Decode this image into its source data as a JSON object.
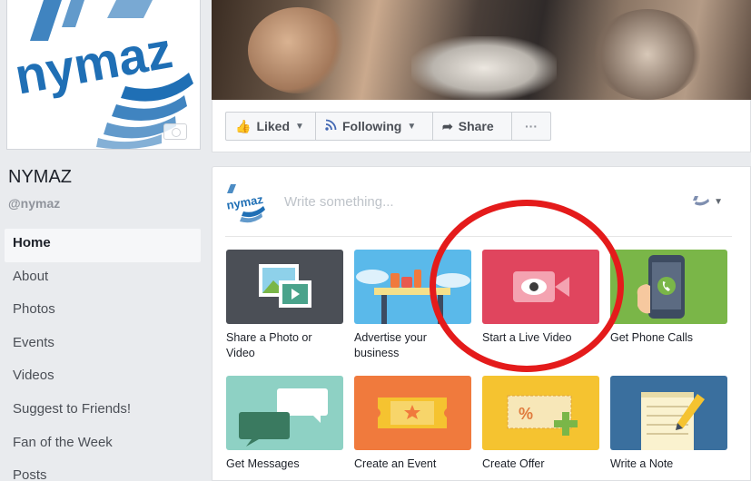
{
  "brand": {
    "logo_text": "nymaz",
    "logo_color": "#1f6fb5"
  },
  "page": {
    "name": "NYMAZ",
    "handle": "@nymaz"
  },
  "nav": {
    "items": [
      {
        "label": "Home",
        "active": true
      },
      {
        "label": "About"
      },
      {
        "label": "Photos"
      },
      {
        "label": "Events"
      },
      {
        "label": "Videos"
      },
      {
        "label": "Suggest to Friends!"
      },
      {
        "label": "Fan of the Week"
      },
      {
        "label": "Posts"
      }
    ]
  },
  "actions": {
    "liked": "Liked",
    "following": "Following",
    "share": "Share",
    "more": "···"
  },
  "composer": {
    "placeholder": "Write something..."
  },
  "tiles": [
    {
      "label": "Share a Photo or Video",
      "color": "#4b4f56"
    },
    {
      "label": "Advertise your business",
      "color": "#5ab9ea"
    },
    {
      "label": "Start a Live Video",
      "color": "#e0455e"
    },
    {
      "label": "Get Phone Calls",
      "color": "#7ab648"
    },
    {
      "label": "Get Messages",
      "color": "#8ed1c4"
    },
    {
      "label": "Create an Event",
      "color": "#f07a3d"
    },
    {
      "label": "Create Offer",
      "color": "#f5c330"
    },
    {
      "label": "Write a Note",
      "color": "#3a6f9e"
    }
  ],
  "annotation": {
    "color": "#e41b1b",
    "target": "Start a Live Video"
  }
}
